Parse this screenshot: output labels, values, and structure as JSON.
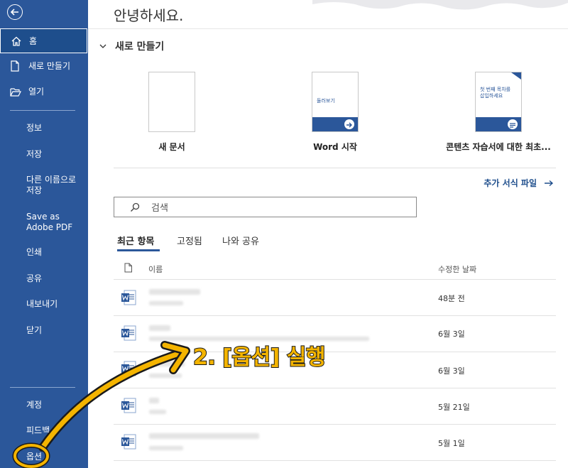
{
  "sidebar": {
    "back_icon": "arrow-left-icon",
    "home": {
      "label": "홈",
      "icon": "home-icon"
    },
    "new": {
      "label": "새로 만들기",
      "icon": "new-document-icon"
    },
    "open": {
      "label": "열기",
      "icon": "folder-open-icon"
    },
    "info": "정보",
    "save": "저장",
    "save_as": "다른 이름으로 저장",
    "save_adobe": "Save as Adobe PDF",
    "print": "인쇄",
    "share": "공유",
    "export": "내보내기",
    "close": "닫기",
    "account": "계정",
    "feedback": "피드백",
    "options": "옵션"
  },
  "header": {
    "greeting": "안녕하세요."
  },
  "new_section": {
    "title": "새로 만들기",
    "templates": [
      {
        "label": "새 문서"
      },
      {
        "label": "Word 시작",
        "thumb_text": "둘러보기"
      },
      {
        "label": "콘텐츠 자습서에 대한 최초...",
        "thumb_text": "첫 번째 목차를 삽입하세요"
      }
    ],
    "more_link": "추가 서식 파일"
  },
  "search": {
    "placeholder": "검색"
  },
  "tabs": [
    {
      "label": "최근 항목",
      "active": true
    },
    {
      "label": "고정됨",
      "active": false
    },
    {
      "label": "나와 공유",
      "active": false
    }
  ],
  "columns": {
    "name": "이름",
    "modified": "수정한 날짜"
  },
  "files": [
    {
      "modified": "48분 전"
    },
    {
      "modified": "6월 3일"
    },
    {
      "modified": "6월 3일"
    },
    {
      "modified": "5월 21일"
    },
    {
      "modified": "5월 1일"
    }
  ],
  "annotation": {
    "text": "2. [옵션] 실행",
    "color": "#f4b400"
  },
  "colors": {
    "sidebar": "#2b579a",
    "accent": "#2b579a",
    "annotation": "#f4b400"
  }
}
